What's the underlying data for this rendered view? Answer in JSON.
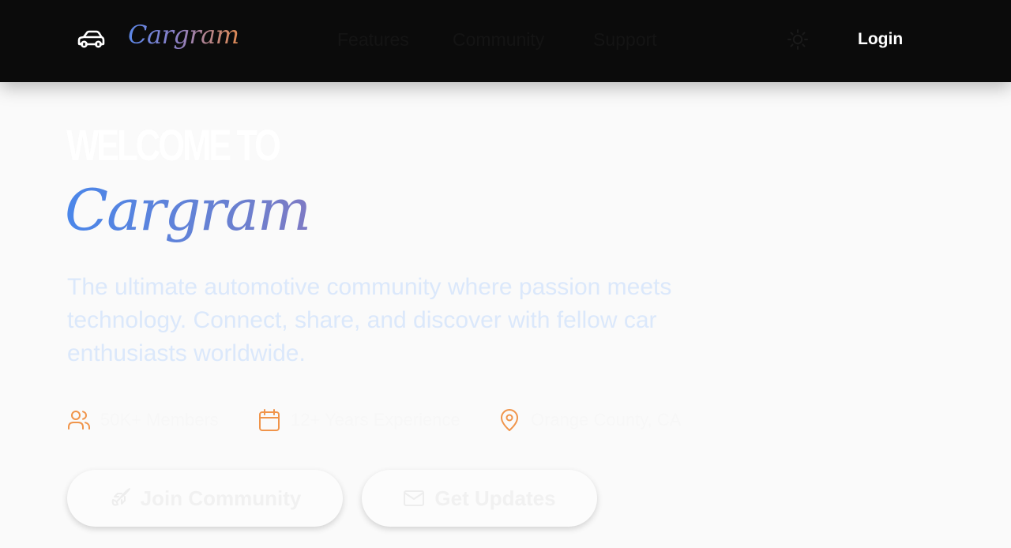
{
  "nav": {
    "brand": "Cargram",
    "links": [
      "Features",
      "Community",
      "Support"
    ],
    "login": "Login"
  },
  "hero": {
    "welcome": "WELCOME TO",
    "brand": "Cargram",
    "description": "The ultimate automotive community where passion meets technology. Connect, share, and discover with fellow car enthusiasts worldwide."
  },
  "stats": [
    {
      "icon": "users-icon",
      "text": "50K+ Members"
    },
    {
      "icon": "calendar-icon",
      "text": "12+ Years Experience"
    },
    {
      "icon": "map-pin-icon",
      "text": "Orange County, CA"
    }
  ],
  "buttons": {
    "join": "Join Community",
    "updates": "Get Updates"
  },
  "colors": {
    "nav_bg": "#0b0b0b",
    "accent_orange": "#f0944a",
    "brand_blue": "#4a86ea",
    "page_bg": "#fafafa"
  }
}
